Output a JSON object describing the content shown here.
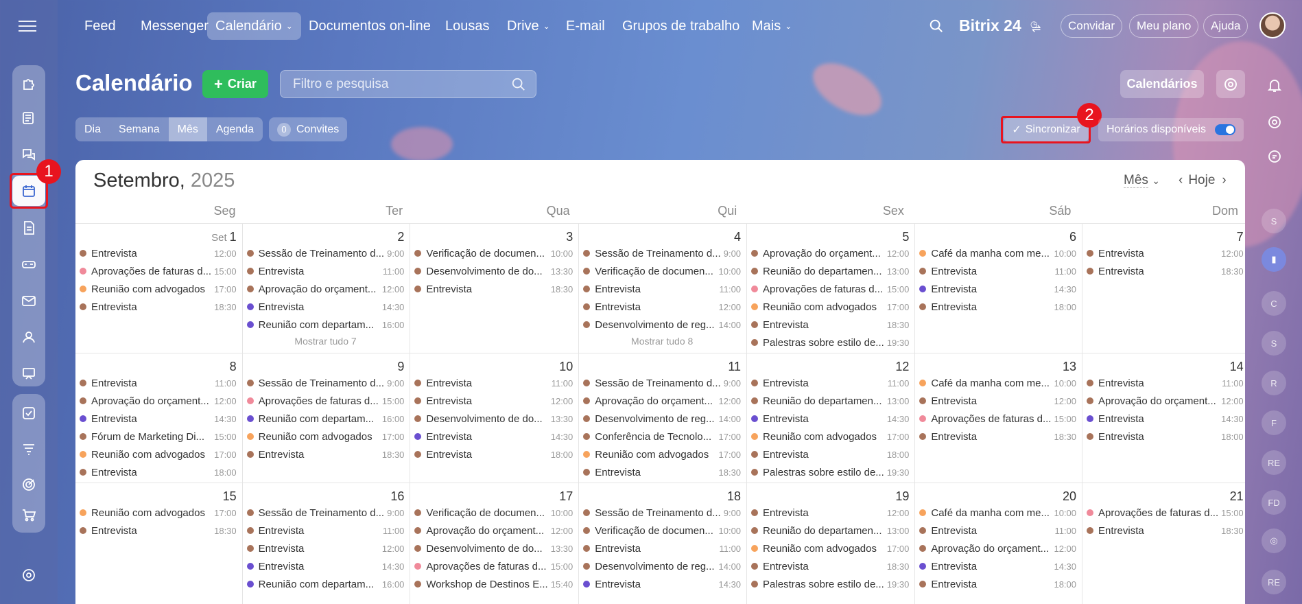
{
  "nav": {
    "items": [
      {
        "label": "Feed",
        "caret": false
      },
      {
        "label": "Messenger",
        "caret": false
      },
      {
        "label": "Calendário",
        "caret": true,
        "active": true
      },
      {
        "label": "Documentos on-line",
        "caret": false
      },
      {
        "label": "Lousas",
        "caret": false
      },
      {
        "label": "Drive",
        "caret": true
      },
      {
        "label": "E-mail",
        "caret": false
      },
      {
        "label": "Grupos de trabalho",
        "caret": false
      },
      {
        "label": "Mais",
        "caret": true
      }
    ],
    "brand": "Bitrix 24",
    "invite": "Convidar",
    "plan": "Meu plano",
    "help": "Ajuda"
  },
  "page": {
    "title": "Calendário",
    "create": "Criar",
    "search_placeholder": "Filtro e pesquisa",
    "calendars": "Calendários",
    "views": [
      "Dia",
      "Semana",
      "Mês",
      "Agenda"
    ],
    "active_view": "Mês",
    "invites_count": "0",
    "invites_label": "Convites",
    "sync": "Sincronizar",
    "availability": "Horários disponíveis",
    "availability_on": true
  },
  "annotations": {
    "badge1": "1",
    "badge2": "2"
  },
  "right_rail_chips": [
    "S",
    "C",
    "S",
    "R",
    "F",
    "RE",
    "FD",
    "RE"
  ],
  "calendar": {
    "month": "Setembro,",
    "year": "2025",
    "mode": "Mês",
    "today": "Hoje",
    "weekdays": [
      "Seg",
      "Ter",
      "Qua",
      "Qui",
      "Sex",
      "Sáb",
      "Dom"
    ],
    "colors": {
      "brown": "#a8735a",
      "pink": "#f08a9a",
      "orange": "#f7a35c",
      "purple": "#6a4fd0"
    },
    "days": [
      {
        "num": "1",
        "month": "Set",
        "events": [
          [
            "brown",
            "Entrevista",
            "12:00"
          ],
          [
            "pink",
            "Aprovações de faturas d...",
            "15:00"
          ],
          [
            "orange",
            "Reunião com advogados",
            "17:00"
          ],
          [
            "brown",
            "Entrevista",
            "18:30"
          ]
        ]
      },
      {
        "num": "2",
        "events": [
          [
            "brown",
            "Sessão de Treinamento d...",
            "9:00"
          ],
          [
            "brown",
            "Entrevista",
            "11:00"
          ],
          [
            "brown",
            "Aprovação do orçament...",
            "12:00"
          ],
          [
            "purple",
            "Entrevista",
            "14:30"
          ],
          [
            "purple",
            "Reunião com departam...",
            "16:00"
          ]
        ],
        "more": "Mostrar tudo 7"
      },
      {
        "num": "3",
        "events": [
          [
            "brown",
            "Verificação de documen...",
            "10:00"
          ],
          [
            "brown",
            "Desenvolvimento de do...",
            "13:30"
          ],
          [
            "brown",
            "Entrevista",
            "18:30"
          ]
        ]
      },
      {
        "num": "4",
        "events": [
          [
            "brown",
            "Sessão de Treinamento d...",
            "9:00"
          ],
          [
            "brown",
            "Verificação de documen...",
            "10:00"
          ],
          [
            "brown",
            "Entrevista",
            "11:00"
          ],
          [
            "brown",
            "Entrevista",
            "12:00"
          ],
          [
            "brown",
            "Desenvolvimento de reg...",
            "14:00"
          ]
        ],
        "more": "Mostrar tudo 8"
      },
      {
        "num": "5",
        "events": [
          [
            "brown",
            "Aprovação do orçament...",
            "12:00"
          ],
          [
            "brown",
            "Reunião do departamen...",
            "13:00"
          ],
          [
            "pink",
            "Aprovações de faturas d...",
            "15:00"
          ],
          [
            "orange",
            "Reunião com advogados",
            "17:00"
          ],
          [
            "brown",
            "Entrevista",
            "18:30"
          ],
          [
            "brown",
            "Palestras sobre estilo de...",
            "19:30"
          ]
        ]
      },
      {
        "num": "6",
        "events": [
          [
            "orange",
            "Café da manha com me...",
            "10:00"
          ],
          [
            "brown",
            "Entrevista",
            "11:00"
          ],
          [
            "purple",
            "Entrevista",
            "14:30"
          ],
          [
            "brown",
            "Entrevista",
            "18:00"
          ]
        ]
      },
      {
        "num": "7",
        "events": [
          [
            "brown",
            "Entrevista",
            "12:00"
          ],
          [
            "brown",
            "Entrevista",
            "18:30"
          ]
        ]
      },
      {
        "num": "8",
        "events": [
          [
            "brown",
            "Entrevista",
            "11:00"
          ],
          [
            "brown",
            "Aprovação do orçament...",
            "12:00"
          ],
          [
            "purple",
            "Entrevista",
            "14:30"
          ],
          [
            "brown",
            "Fórum de Marketing Di...",
            "15:00"
          ],
          [
            "orange",
            "Reunião com advogados",
            "17:00"
          ],
          [
            "brown",
            "Entrevista",
            "18:00"
          ]
        ]
      },
      {
        "num": "9",
        "events": [
          [
            "brown",
            "Sessão de Treinamento d...",
            "9:00"
          ],
          [
            "pink",
            "Aprovações de faturas d...",
            "15:00"
          ],
          [
            "purple",
            "Reunião com departam...",
            "16:00"
          ],
          [
            "orange",
            "Reunião com advogados",
            "17:00"
          ],
          [
            "brown",
            "Entrevista",
            "18:30"
          ]
        ]
      },
      {
        "num": "10",
        "events": [
          [
            "brown",
            "Entrevista",
            "11:00"
          ],
          [
            "brown",
            "Entrevista",
            "12:00"
          ],
          [
            "brown",
            "Desenvolvimento de do...",
            "13:30"
          ],
          [
            "purple",
            "Entrevista",
            "14:30"
          ],
          [
            "brown",
            "Entrevista",
            "18:00"
          ]
        ]
      },
      {
        "num": "11",
        "events": [
          [
            "brown",
            "Sessão de Treinamento d...",
            "9:00"
          ],
          [
            "brown",
            "Aprovação do orçament...",
            "12:00"
          ],
          [
            "brown",
            "Desenvolvimento de reg...",
            "14:00"
          ],
          [
            "brown",
            "Conferência de Tecnolo...",
            "17:00"
          ],
          [
            "orange",
            "Reunião com advogados",
            "17:00"
          ],
          [
            "brown",
            "Entrevista",
            "18:30"
          ]
        ]
      },
      {
        "num": "12",
        "events": [
          [
            "brown",
            "Entrevista",
            "11:00"
          ],
          [
            "brown",
            "Reunião do departamen...",
            "13:00"
          ],
          [
            "purple",
            "Entrevista",
            "14:30"
          ],
          [
            "orange",
            "Reunião com advogados",
            "17:00"
          ],
          [
            "brown",
            "Entrevista",
            "18:00"
          ],
          [
            "brown",
            "Palestras sobre estilo de...",
            "19:30"
          ]
        ]
      },
      {
        "num": "13",
        "events": [
          [
            "orange",
            "Café da manha com me...",
            "10:00"
          ],
          [
            "brown",
            "Entrevista",
            "12:00"
          ],
          [
            "pink",
            "Aprovações de faturas d...",
            "15:00"
          ],
          [
            "brown",
            "Entrevista",
            "18:30"
          ]
        ]
      },
      {
        "num": "14",
        "events": [
          [
            "brown",
            "Entrevista",
            "11:00"
          ],
          [
            "brown",
            "Aprovação do orçament...",
            "12:00"
          ],
          [
            "purple",
            "Entrevista",
            "14:30"
          ],
          [
            "brown",
            "Entrevista",
            "18:00"
          ]
        ]
      },
      {
        "num": "15",
        "events": [
          [
            "orange",
            "Reunião com advogados",
            "17:00"
          ],
          [
            "brown",
            "Entrevista",
            "18:30"
          ]
        ]
      },
      {
        "num": "16",
        "events": [
          [
            "brown",
            "Sessão de Treinamento d...",
            "9:00"
          ],
          [
            "brown",
            "Entrevista",
            "11:00"
          ],
          [
            "brown",
            "Entrevista",
            "12:00"
          ],
          [
            "purple",
            "Entrevista",
            "14:30"
          ],
          [
            "purple",
            "Reunião com departam...",
            "16:00"
          ]
        ]
      },
      {
        "num": "17",
        "events": [
          [
            "brown",
            "Verificação de documen...",
            "10:00"
          ],
          [
            "brown",
            "Aprovação do orçament...",
            "12:00"
          ],
          [
            "brown",
            "Desenvolvimento de do...",
            "13:30"
          ],
          [
            "pink",
            "Aprovações de faturas d...",
            "15:00"
          ],
          [
            "brown",
            "Workshop de Destinos E...",
            "15:40"
          ]
        ]
      },
      {
        "num": "18",
        "events": [
          [
            "brown",
            "Sessão de Treinamento d...",
            "9:00"
          ],
          [
            "brown",
            "Verificação de documen...",
            "10:00"
          ],
          [
            "brown",
            "Entrevista",
            "11:00"
          ],
          [
            "brown",
            "Desenvolvimento de reg...",
            "14:00"
          ],
          [
            "purple",
            "Entrevista",
            "14:30"
          ]
        ]
      },
      {
        "num": "19",
        "events": [
          [
            "brown",
            "Entrevista",
            "12:00"
          ],
          [
            "brown",
            "Reunião do departamen...",
            "13:00"
          ],
          [
            "orange",
            "Reunião com advogados",
            "17:00"
          ],
          [
            "brown",
            "Entrevista",
            "18:30"
          ],
          [
            "brown",
            "Palestras sobre estilo de...",
            "19:30"
          ]
        ]
      },
      {
        "num": "20",
        "events": [
          [
            "orange",
            "Café da manha com me...",
            "10:00"
          ],
          [
            "brown",
            "Entrevista",
            "11:00"
          ],
          [
            "brown",
            "Aprovação do orçament...",
            "12:00"
          ],
          [
            "purple",
            "Entrevista",
            "14:30"
          ],
          [
            "brown",
            "Entrevista",
            "18:00"
          ]
        ]
      },
      {
        "num": "21",
        "events": [
          [
            "pink",
            "Aprovações de faturas d...",
            "15:00"
          ],
          [
            "brown",
            "Entrevista",
            "18:30"
          ]
        ]
      }
    ]
  }
}
